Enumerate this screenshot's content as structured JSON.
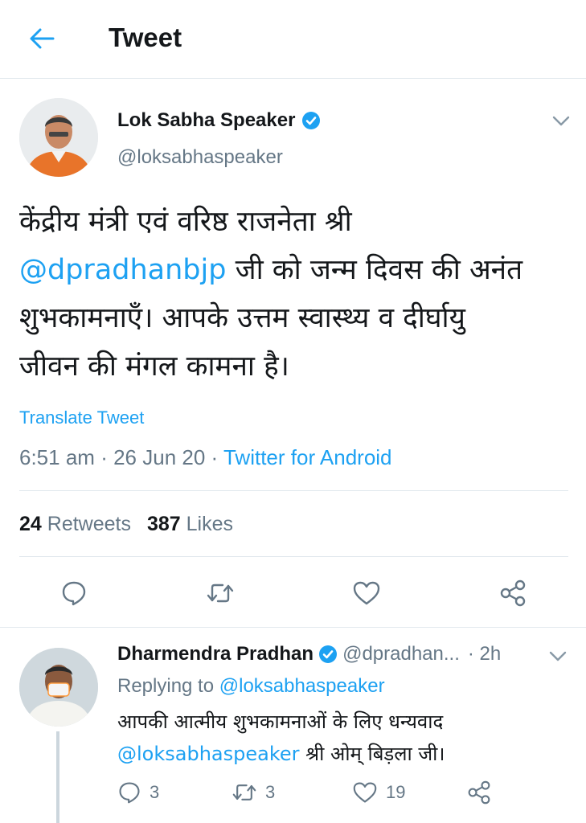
{
  "header": {
    "title": "Tweet"
  },
  "tweet": {
    "author_name": "Lok Sabha Speaker",
    "author_handle": "@loksabhaspeaker",
    "text_line1": "केंद्रीय मंत्री एवं वरिष्ठ राजनेता श्री",
    "mention": "@dpradhanbjp",
    "text_line2_rest": " जी को जन्म दिवस की अनंत",
    "text_line3": "शुभकामनाएँ। आपके उत्तम स्वास्थ्य व दीर्घायु",
    "text_line4": "जीवन की मंगल कामना है।",
    "translate_label": "Translate Tweet",
    "time": "6:51 am",
    "date": "26 Jun 20",
    "separator": "·",
    "source": "Twitter for Android",
    "retweets_count": "24",
    "retweets_label": "Retweets",
    "likes_count": "387",
    "likes_label": "Likes"
  },
  "reply": {
    "author_name": "Dharmendra Pradhan",
    "author_handle": "@dpradhan...",
    "time": "· 2h",
    "replying_prefix": "Replying to ",
    "replying_to": "@loksabhaspeaker",
    "text_line1": "आपकी आत्मीय शुभकामनाओं के लिए धन्यवाद",
    "mention": "@loksabhaspeaker",
    "text_line2_rest": " श्री ओम् बिड़ला जी।",
    "reply_count": "3",
    "retweet_count": "3",
    "like_count": "19"
  },
  "icons": {
    "back": "arrow-left-icon",
    "verified": "verified-badge-icon",
    "more": "chevron-down-icon",
    "reply": "comment-icon",
    "retweet": "retweet-icon",
    "like": "heart-icon",
    "share": "share-icon"
  },
  "colors": {
    "accent": "#1da1f2",
    "text": "#14171a",
    "secondary": "#657786",
    "divider": "#e1e8ed"
  }
}
